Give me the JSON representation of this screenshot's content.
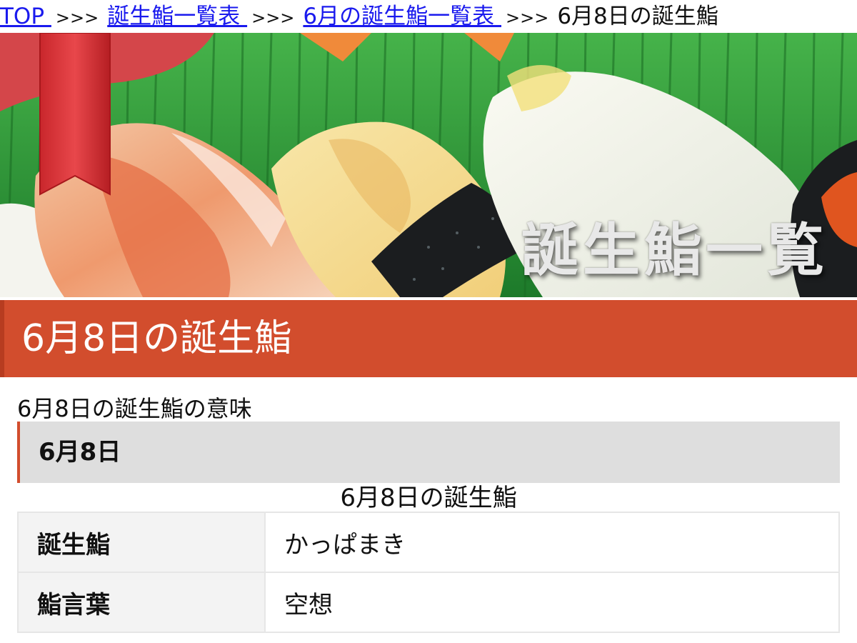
{
  "breadcrumb": {
    "items": [
      {
        "label": "TOP ",
        "link": true
      },
      {
        "label": "誕生鮨一覧表 ",
        "link": true
      },
      {
        "label": "6月の誕生鮨一覧表 ",
        "link": true
      },
      {
        "label": "6月8日の誕生鮨",
        "link": false
      }
    ],
    "separator": ">>>"
  },
  "banner": {
    "title": "誕生鮨一覧"
  },
  "page": {
    "title": "6月8日の誕生鮨",
    "meaning_heading": "6月8日の誕生鮨の意味",
    "date_label": "6月8日"
  },
  "table": {
    "caption": "6月8日の誕生鮨",
    "rows": [
      {
        "header": "誕生鮨",
        "value": "かっぱまき"
      },
      {
        "header": "鮨言葉",
        "value": "空想"
      }
    ]
  },
  "colors": {
    "accent": "#d24d2d",
    "link": "#1a1aee",
    "date_box_bg": "#dedede",
    "table_header_bg": "#f3f3f3"
  }
}
